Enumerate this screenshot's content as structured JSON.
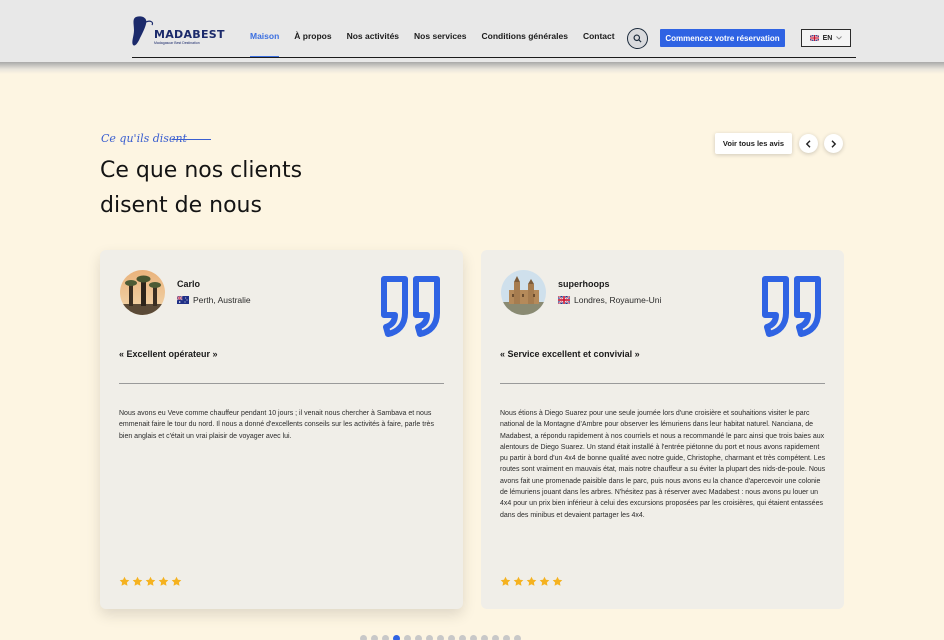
{
  "header": {
    "logo_text": "MADABEST",
    "logo_tagline": "Madagascar Best Destination",
    "nav": [
      {
        "label": "Maison",
        "active": true
      },
      {
        "label": "À propos",
        "active": false
      },
      {
        "label": "Nos activités",
        "active": false
      },
      {
        "label": "Nos services",
        "active": false
      },
      {
        "label": "Conditions générales",
        "active": false
      },
      {
        "label": "Contact",
        "active": false
      }
    ],
    "search_icon": "search-icon",
    "cta_label": "Commencez votre réservation",
    "language": "EN",
    "accent_color": "#2f63e3"
  },
  "section": {
    "eyebrow": "Ce qu'ils disent",
    "title_line1": "Ce que nos clients",
    "title_line2": "disent de nous",
    "view_all_label": "Voir tous les avis"
  },
  "reviews": [
    {
      "name": "Carlo",
      "location": "Perth, Australie",
      "flag": "australia-flag",
      "title": "« Excellent opérateur »",
      "text": "Nous avons eu Veve comme chauffeur pendant 10 jours ; il venait nous chercher à Sambava et nous emmenait faire le tour du nord. Il nous a donné d'excellents conseils sur les activités à faire, parle très bien anglais et c'était un vrai plaisir de voyager avec lui.",
      "rating": 5
    },
    {
      "name": "superhoops",
      "location": "Londres, Royaume-Uni",
      "flag": "uk-flag",
      "title": "« Service excellent et convivial »",
      "text": "Nous étions à Diego Suarez pour une seule journée lors d'une croisière et souhaitions visiter le parc national de la Montagne d'Ambre pour observer les lémuriens dans leur habitat naturel. Nanciana, de Madabest, a répondu rapidement à nos courriels et nous a recommandé le parc ainsi que trois baies aux alentours de Diego Suarez. Un stand était installé à l'entrée piétonne du port et nous avons rapidement pu partir à bord d'un 4x4 de bonne qualité avec notre guide, Christophe, charmant et très compétent. Les routes sont vraiment en mauvais état, mais notre chauffeur a su éviter la plupart des nids-de-poule. Nous avons fait une promenade paisible dans le parc, puis nous avons eu la chance d'apercevoir une colonie de lémuriens jouant dans les arbres. N'hésitez pas à réserver avec Madabest : nous avons pu louer un 4x4 pour un prix bien inférieur à celui des excursions proposées par les croisières, qui étaient entassées dans des minibus et devaient partager les 4x4.",
      "rating": 5
    }
  ],
  "pagination": {
    "total": 15,
    "active_index": 3
  },
  "colors": {
    "star": "#f5b21f",
    "quote": "#2f63e3",
    "background": "#fdf5e2"
  }
}
